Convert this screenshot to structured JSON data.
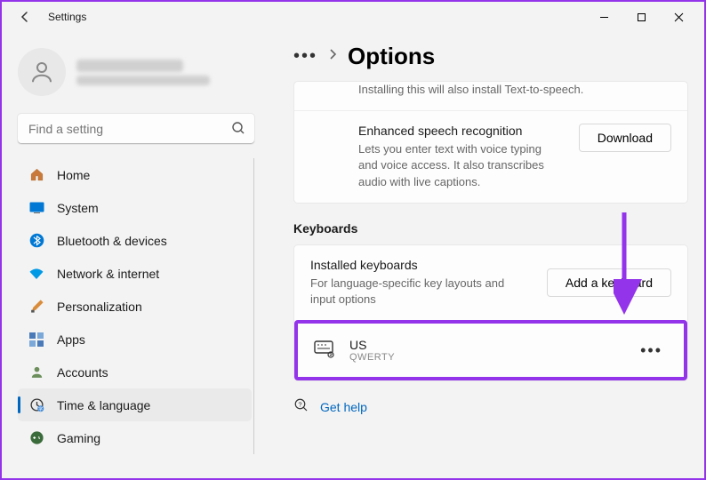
{
  "app": {
    "title": "Settings"
  },
  "search": {
    "placeholder": "Find a setting"
  },
  "nav": {
    "items": [
      {
        "label": "Home",
        "icon": "home"
      },
      {
        "label": "System",
        "icon": "system"
      },
      {
        "label": "Bluetooth & devices",
        "icon": "bluetooth"
      },
      {
        "label": "Network & internet",
        "icon": "wifi"
      },
      {
        "label": "Personalization",
        "icon": "paint"
      },
      {
        "label": "Apps",
        "icon": "apps"
      },
      {
        "label": "Accounts",
        "icon": "account"
      },
      {
        "label": "Time & language",
        "icon": "clock"
      },
      {
        "label": "Gaming",
        "icon": "gaming"
      }
    ]
  },
  "breadcrumb": {
    "title": "Options"
  },
  "speech": {
    "install_tail": "Installing this will also install Text-to-speech.",
    "esr_title": "Enhanced speech recognition",
    "esr_desc": "Lets you enter text with voice typing and voice access. It also transcribes audio with live captions.",
    "download": "Download"
  },
  "keyboards": {
    "group": "Keyboards",
    "installed_title": "Installed keyboards",
    "installed_desc": "For language-specific key layouts and input options",
    "add": "Add a keyboard",
    "item": {
      "name": "US",
      "layout": "QWERTY"
    }
  },
  "help": {
    "label": "Get help"
  }
}
